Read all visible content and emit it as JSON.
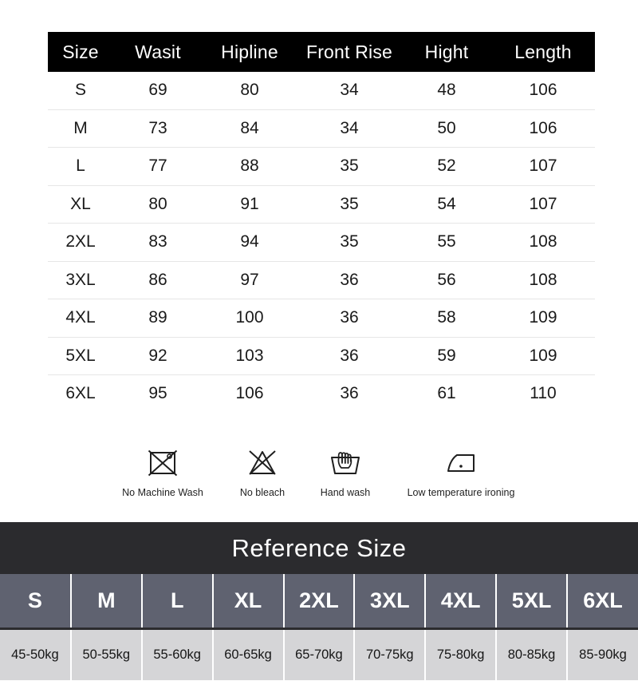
{
  "size_table": {
    "headers": [
      "Size",
      "Wasit",
      "Hipline",
      "Front Rise",
      "Hight",
      "Length"
    ],
    "rows": [
      {
        "size": "S",
        "waist": "69",
        "hipline": "80",
        "front_rise": "34",
        "hight": "48",
        "length": "106"
      },
      {
        "size": "M",
        "waist": "73",
        "hipline": "84",
        "front_rise": "34",
        "hight": "50",
        "length": "106"
      },
      {
        "size": "L",
        "waist": "77",
        "hipline": "88",
        "front_rise": "35",
        "hight": "52",
        "length": "107"
      },
      {
        "size": "XL",
        "waist": "80",
        "hipline": "91",
        "front_rise": "35",
        "hight": "54",
        "length": "107"
      },
      {
        "size": "2XL",
        "waist": "83",
        "hipline": "94",
        "front_rise": "35",
        "hight": "55",
        "length": "108"
      },
      {
        "size": "3XL",
        "waist": "86",
        "hipline": "97",
        "front_rise": "36",
        "hight": "56",
        "length": "108"
      },
      {
        "size": "4XL",
        "waist": "89",
        "hipline": "100",
        "front_rise": "36",
        "hight": "58",
        "length": "109"
      },
      {
        "size": "5XL",
        "waist": "92",
        "hipline": "103",
        "front_rise": "36",
        "hight": "59",
        "length": "109"
      },
      {
        "size": "6XL",
        "waist": "95",
        "hipline": "106",
        "front_rise": "36",
        "hight": "61",
        "length": "110"
      }
    ],
    "header_bg": "#000000",
    "header_text_color": "#ffffff",
    "row_divider_color": "#e6e6e6"
  },
  "care_instructions": [
    {
      "icon": "no-machine-wash-icon",
      "label": "No Machine Wash"
    },
    {
      "icon": "no-bleach-icon",
      "label": "No bleach"
    },
    {
      "icon": "hand-wash-icon",
      "label": "Hand wash"
    },
    {
      "icon": "low-temp-iron-icon",
      "label": "Low temperature ironing"
    }
  ],
  "reference_size": {
    "title": "Reference Size",
    "banner_bg": "#2b2b2e",
    "size_row_bg": "#5f6270",
    "weight_row_bg": "#d5d5d7",
    "sizes": [
      "S",
      "M",
      "L",
      "XL",
      "2XL",
      "3XL",
      "4XL",
      "5XL",
      "6XL"
    ],
    "weights": [
      "45-50kg",
      "50-55kg",
      "55-60kg",
      "60-65kg",
      "65-70kg",
      "70-75kg",
      "75-80kg",
      "80-85kg",
      "85-90kg"
    ]
  }
}
